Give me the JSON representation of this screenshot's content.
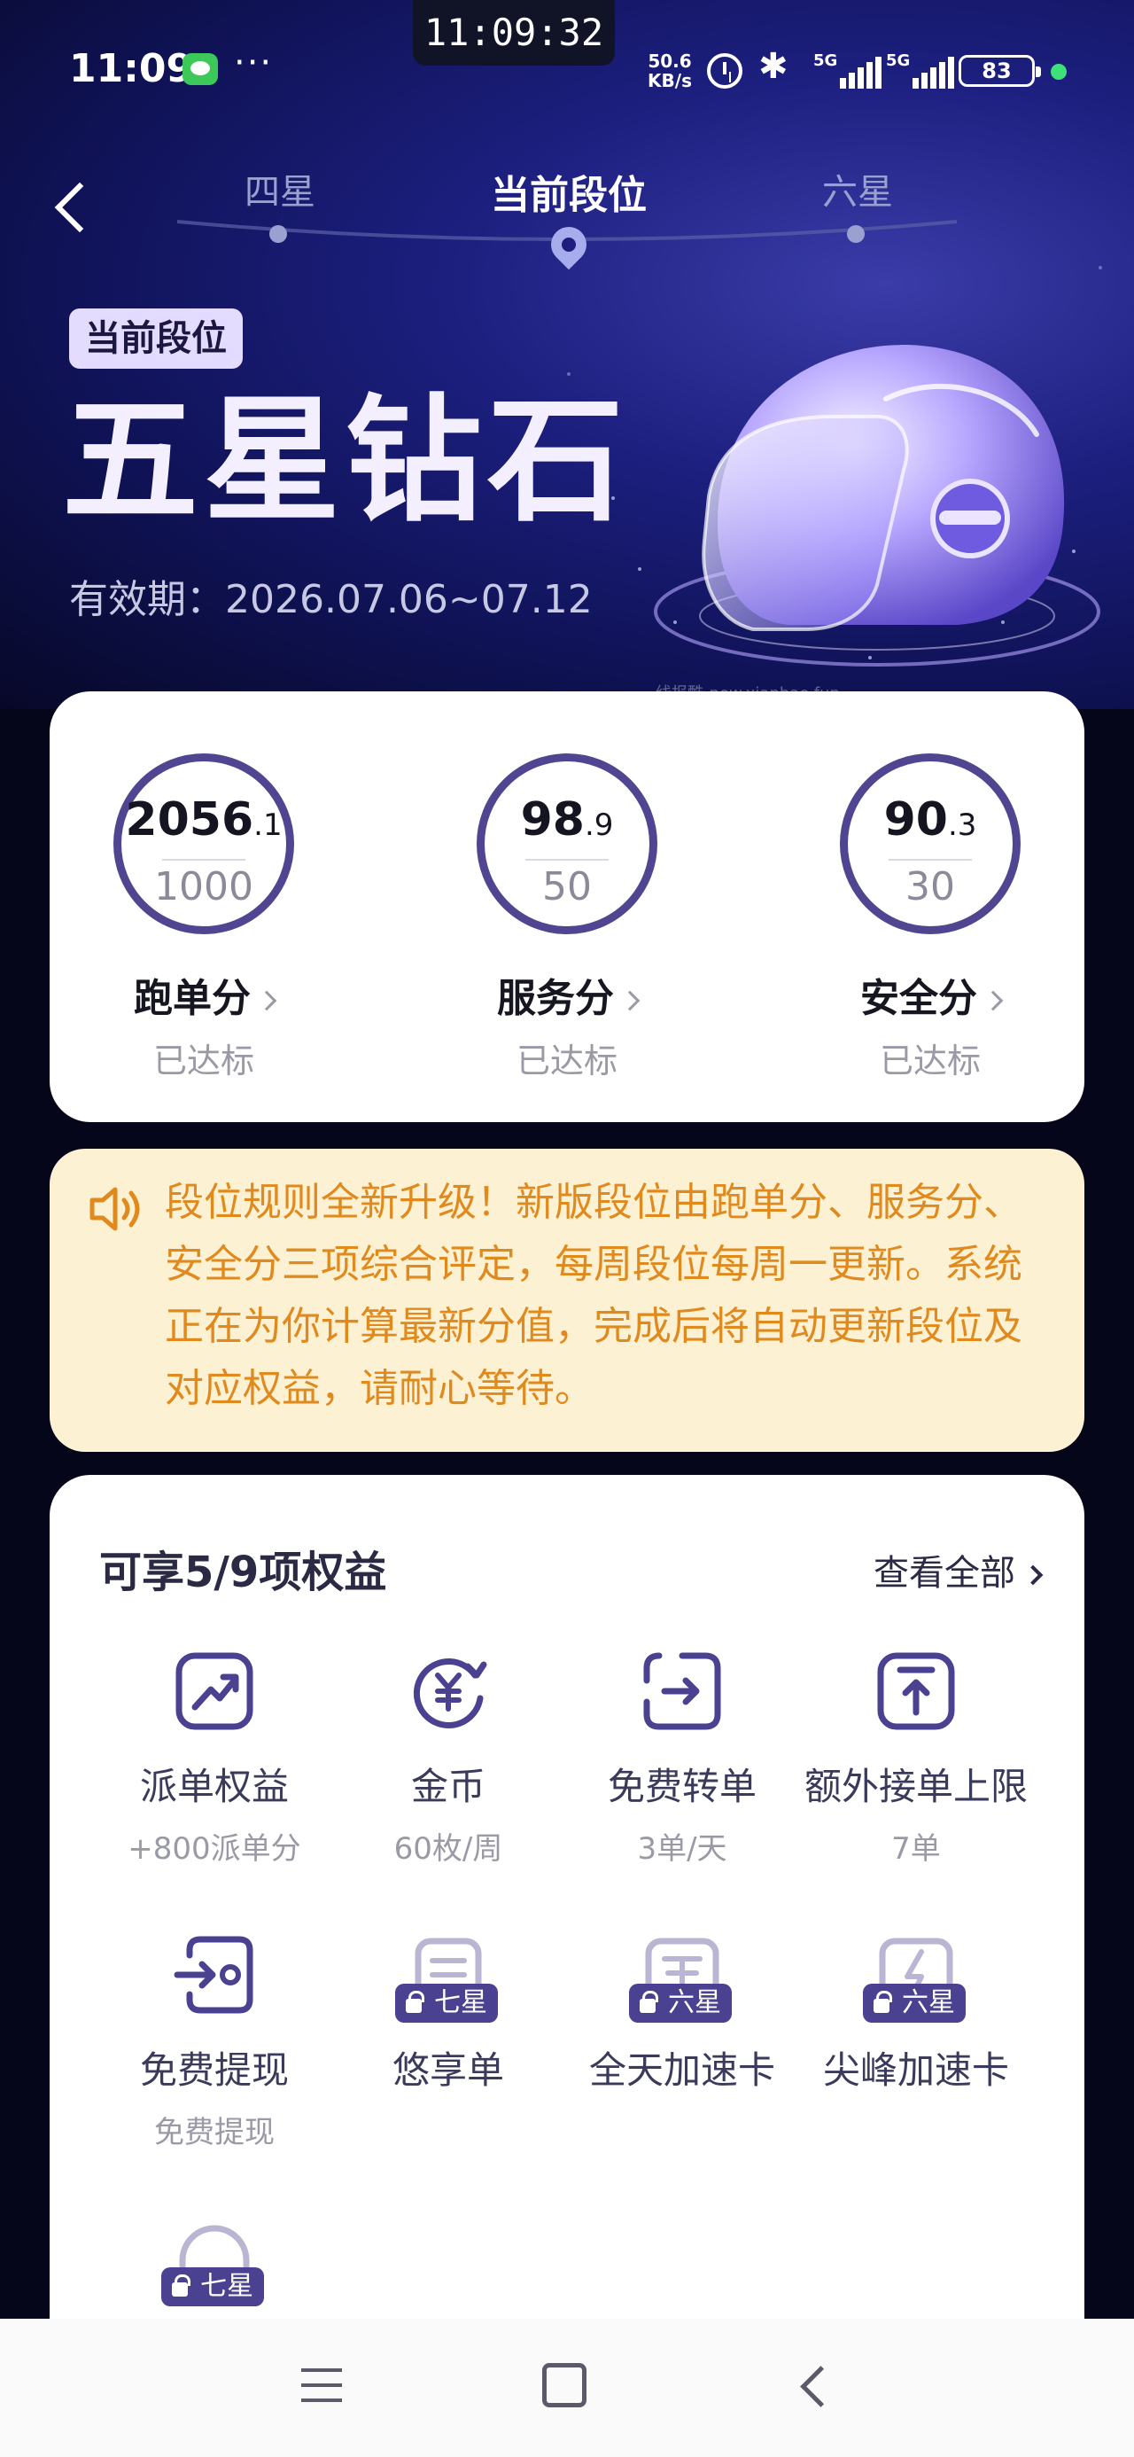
{
  "status_bar": {
    "time": "11:09",
    "center_time": "11:09:32",
    "more": "···",
    "net_speed_value": "50.6",
    "net_speed_unit": "KB/s",
    "signal1": "5G",
    "signal2": "5G",
    "battery": "83"
  },
  "tiers": {
    "prev": "四星",
    "current": "当前段位",
    "next": "六星"
  },
  "rank": {
    "tag": "当前段位",
    "name": "五星钻石",
    "validity": "有效期：2026.07.06~07.12"
  },
  "watermark": "线报酷-new.xianbao.fun",
  "scores": [
    {
      "value_int": "2056",
      "value_dec": ".1",
      "target": "1000",
      "name": "跑单分",
      "status": "已达标"
    },
    {
      "value_int": "98",
      "value_dec": ".9",
      "target": "50",
      "name": "服务分",
      "status": "已达标"
    },
    {
      "value_int": "90",
      "value_dec": ".3",
      "target": "30",
      "name": "安全分",
      "status": "已达标"
    }
  ],
  "notice": {
    "text": "段位规则全新升级！新版段位由跑单分、服务分、安全分三项综合评定，每周段位每周一更新。系统正在为你计算最新分值，完成后将自动更新段位及对应权益，请耐心等待。"
  },
  "benefits": {
    "title": "可享5/9项权益",
    "view_all": "查看全部",
    "items": [
      {
        "name": "派单权益",
        "desc": "+800派单分",
        "icon": "trend-up-icon"
      },
      {
        "name": "金币",
        "desc": "60枚/周",
        "icon": "yuan-coin-icon"
      },
      {
        "name": "免费转单",
        "desc": "3单/天",
        "icon": "transfer-icon"
      },
      {
        "name": "额外接单上限",
        "desc": "7单",
        "icon": "upload-limit-icon"
      },
      {
        "name": "免费提现",
        "desc": "免费提现",
        "icon": "withdraw-icon"
      },
      {
        "name": "悠享单",
        "lock": "七星",
        "icon": "document-icon"
      },
      {
        "name": "全天加速卡",
        "lock": "六星",
        "icon": "speed-card-icon"
      },
      {
        "name": "尖峰加速卡",
        "lock": "六星",
        "icon": "lightning-card-icon"
      },
      {
        "lock": "七星",
        "icon": "locked-benefit-icon"
      }
    ]
  },
  "colors": {
    "accent": "#4f4591",
    "notice_text": "#e08a1e",
    "notice_bg": "#fdf1d4"
  }
}
